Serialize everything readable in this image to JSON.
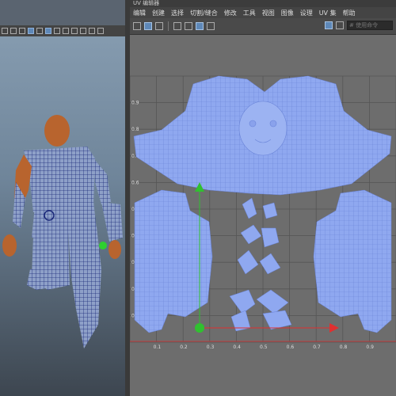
{
  "uv_editor": {
    "title": "UV 编辑器",
    "menu": [
      "编辑",
      "创建",
      "选择",
      "切割/缝合",
      "修改",
      "工具",
      "视图",
      "图像",
      "设理",
      "UV 集",
      "帮助"
    ],
    "search_placeholder": "# 使用命令"
  },
  "uv_grid": {
    "x_ticks": [
      "0.1",
      "0.2",
      "0.3",
      "0.4",
      "0.5",
      "0.6",
      "0.7",
      "0.8",
      "0.9"
    ],
    "y_ticks": [
      "0.9",
      "0.8",
      "0.7",
      "0.6",
      "0.5",
      "0.4",
      "0.3",
      "0.2",
      "0.1"
    ]
  },
  "colors": {
    "uv_shell": "#8fa8f0",
    "uv_wire": "#6a84d8",
    "grid_line": "#555555",
    "canvas_bg": "#6d6d6d",
    "axis_x": "#e03030",
    "axis_y": "#30c030",
    "character_skin": "#b8642e",
    "character_wire": "#1c2a7a"
  },
  "icons": [
    "translate-icon",
    "rotate-icon",
    "scale-icon",
    "checker-icon",
    "grid-icon",
    "pin-icon"
  ]
}
